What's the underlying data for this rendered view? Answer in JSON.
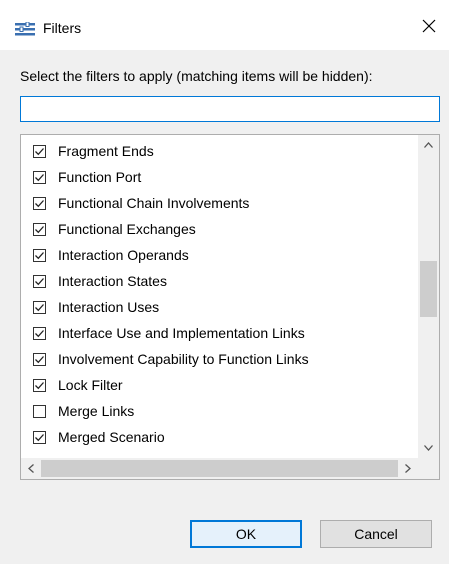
{
  "window": {
    "title": "Filters",
    "icon": "filters-icon",
    "close_icon": "close-icon"
  },
  "prompt": "Select the filters to apply (matching items will be hidden):",
  "filter_input": {
    "value": "",
    "placeholder": ""
  },
  "items": [
    {
      "label": "Fragment Ends",
      "checked": true
    },
    {
      "label": "Function Port",
      "checked": true
    },
    {
      "label": "Functional Chain Involvements",
      "checked": true
    },
    {
      "label": "Functional Exchanges",
      "checked": true
    },
    {
      "label": "Interaction Operands",
      "checked": true
    },
    {
      "label": "Interaction States",
      "checked": true
    },
    {
      "label": "Interaction Uses",
      "checked": true
    },
    {
      "label": "Interface Use and Implementation Links",
      "checked": true
    },
    {
      "label": "Involvement Capability to Function Links",
      "checked": true
    },
    {
      "label": "Lock Filter",
      "checked": true
    },
    {
      "label": "Merge Links",
      "checked": false
    },
    {
      "label": "Merged Scenario",
      "checked": true
    }
  ],
  "buttons": {
    "ok": "OK",
    "cancel": "Cancel"
  },
  "colors": {
    "accent": "#0078d7",
    "dialog_bg": "#f0f0f0",
    "scroll_thumb": "#cdcdcd"
  }
}
